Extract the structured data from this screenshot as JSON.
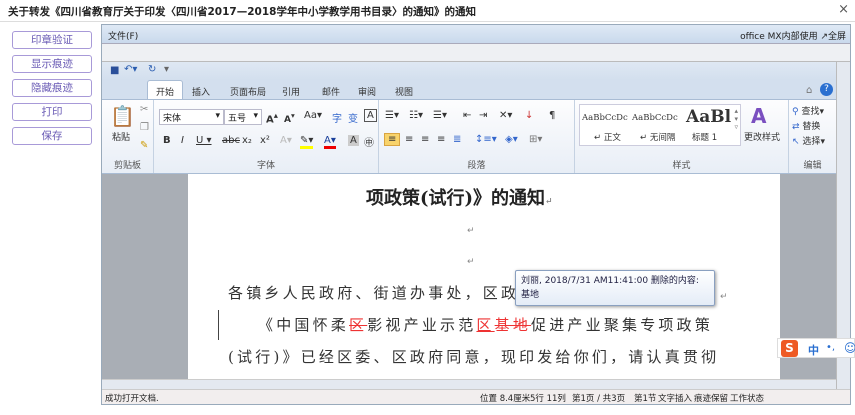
{
  "window": {
    "title": "关于转发《四川省教育厅关于印发〈四川省2017—2018学年中小学教学用书目录〉的通知》的通知",
    "close": "×"
  },
  "side_buttons": [
    "印章验证",
    "显示痕迹",
    "隐藏痕迹",
    "打印",
    "保存"
  ],
  "menubar": {
    "file": "文件(F)",
    "right_label": "office MX内部使用",
    "fullscreen": "↗全屏"
  },
  "tabs": [
    "开始",
    "插入",
    "页面布局",
    "引用",
    "邮件",
    "审阅",
    "视图"
  ],
  "ribbon": {
    "clipboard": {
      "paste": "粘贴",
      "label": "剪贴板"
    },
    "font": {
      "name": "宋体",
      "size": "五号",
      "label": "字体"
    },
    "paragraph": {
      "label": "段落"
    },
    "styles": {
      "items": [
        {
          "preview": "AaBbCcDc",
          "name": "↵ 正文"
        },
        {
          "preview": "AaBbCcDc",
          "name": "↵ 无间隔"
        },
        {
          "preview": "AaBl",
          "name": "标题 1"
        }
      ],
      "change": "更改样式",
      "label": "样式"
    },
    "editing": {
      "find": "查找",
      "replace": "替换",
      "select": "选择",
      "label": "编辑"
    }
  },
  "document": {
    "heading": "项政策(试行)》的通知",
    "line1": "各镇乡人民政府、街道办事处，区政府",
    "line2_a": "《中国怀柔",
    "line2_del1": "区",
    "line2_b": "影视产业示范",
    "line2_ins": "区",
    "line2_del2": "基地",
    "line2_c": "促进产业聚集专项政策",
    "line3": "(试行)》已经区委、区政府同意，现印发给你们，请认真贯彻"
  },
  "tooltip": {
    "line1": "刘丽, 2018/7/31 AM11:41:00 删除的内容:",
    "line2": "基地"
  },
  "status": {
    "message": "成功打开文档.",
    "position": "位置 8.4厘米",
    "rowcol": "5行 11列",
    "page": "第1页 / 共3页",
    "section": "第1节",
    "insert": "文字插入",
    "track": "痕迹保留",
    "work": "工作状态"
  },
  "ime": {
    "lang": "中",
    "punct": "•,"
  }
}
